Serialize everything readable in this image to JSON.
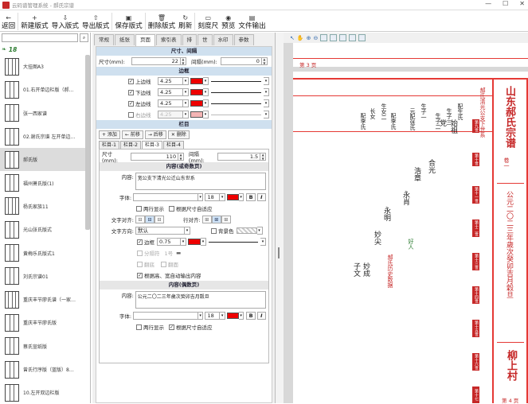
{
  "window": {
    "title": "云码谱管理系统 - 郝氏宗谱",
    "controls": [
      "—",
      "☐",
      "✕"
    ]
  },
  "toolbar": [
    {
      "icon": "←",
      "label": "返回"
    },
    {
      "icon": "+",
      "label": "新建版式"
    },
    {
      "icon": "⇩",
      "label": "导入版式"
    },
    {
      "icon": "⇧",
      "label": "导出版式"
    },
    {
      "icon": "▣",
      "label": "保存版式"
    },
    {
      "icon": "🗑",
      "label": "删除版式"
    },
    {
      "icon": "↻",
      "label": "刷新"
    },
    {
      "icon": "▭",
      "label": "刻度尺"
    },
    {
      "icon": "◉",
      "label": "预览"
    },
    {
      "icon": "▤",
      "label": "文件输出"
    }
  ],
  "left": {
    "search_placeholder": "",
    "count": "18",
    "items": [
      {
        "label": "大挂图A3",
        "cols": 4
      },
      {
        "label": "01.右开单边栏版（郝…",
        "cols": 3
      },
      {
        "label": "张一西家谱",
        "cols": 3
      },
      {
        "label": "02.谢氏宗谱 左开单边…",
        "cols": 3
      },
      {
        "label": "郝氏版",
        "cols": 3,
        "selected": true
      },
      {
        "label": "福州萧氏版(1)",
        "cols": 3
      },
      {
        "label": "杨氏家族11",
        "cols": 4
      },
      {
        "label": "光山张氏版式",
        "cols": 3
      },
      {
        "label": "黄梅乐氏版式1",
        "cols": 3
      },
      {
        "label": "刘氏宗谱01",
        "cols": 3
      },
      {
        "label": "重庆丰节廖氏谱（一家…",
        "cols": 4
      },
      {
        "label": "重庆丰节廖氏版",
        "cols": 3
      },
      {
        "label": "蔡氏宣纸版",
        "cols": 3
      },
      {
        "label": "曾氏行序版（蓝版）8…",
        "cols": 3
      },
      {
        "label": "10.左开双边栏版",
        "cols": 3
      }
    ]
  },
  "mid": {
    "tabs": [
      "常规",
      "纸张",
      "页面",
      "索引表",
      "排",
      "世",
      "水印",
      "参数"
    ],
    "active_tab": "页面",
    "sec_size": "尺寸、间隔",
    "size_label": "尺寸(mm):",
    "size_value": "22",
    "gap_label": "间隔(mm):",
    "gap_value": "0",
    "sec_border": "边框",
    "borders": [
      {
        "label": "上边线",
        "value": "4.25",
        "checked": true
      },
      {
        "label": "下边线",
        "value": "4.25",
        "checked": true
      },
      {
        "label": "左边线",
        "value": "4.25",
        "checked": true
      },
      {
        "label": "右边线",
        "value": "4.25",
        "checked": false
      }
    ],
    "sec_col": "栏目",
    "col_buttons": [
      "+ 添加",
      "← 前移",
      "→ 后移",
      "✕ 删除"
    ],
    "col_tabs": [
      "栏目-1",
      "栏目-2",
      "栏目-3",
      "栏目-4"
    ],
    "col_active": "栏目-3",
    "col_size_label": "尺寸(mm):",
    "col_size_value": "110",
    "col_gap_label": "间隔(mm):",
    "col_gap_value": "1.5",
    "odd_head": "内容(或奇数页)",
    "content_label": "内容:",
    "odd_content": "宽公支下清光公迁山东世系",
    "font_label": "字体:",
    "font_size": "18",
    "bold": "B",
    "italic": "I",
    "two_line": "两行显示",
    "fit_size": "根据尺寸自适应",
    "align_label": "文字对齐:",
    "row_label": "行对齐:",
    "dir_label": "文字方向:",
    "dir_value": "默认",
    "bg_label": "背景色",
    "border_label": "边框",
    "border_value": "0.75",
    "sep_label": "分隔符",
    "sep_value": "1号",
    "flip_h": "翻底",
    "flip_v": "翻面",
    "fit_rotate": "根据高、宽自动输出内容",
    "even_head": "内容(偶数页)",
    "even_content": "公元二〇二三年歲次癸卯吉月穀旦",
    "two_line2": "两行显示",
    "fit_size2": "根据尺寸自适应"
  },
  "preview": {
    "page_top": "第 3 页",
    "page_bottom": "第 4 页",
    "title": "山东郝氏宗谱",
    "volume": "卷一",
    "subtitle": "郝氏清光公支下世系",
    "date": "公元二〇二三年歲次癸卯吉月穀旦",
    "village": "柳上村",
    "gens": [
      "第九世",
      "第十世",
      "第十一世",
      "第十二世",
      "第十三世",
      "第十四世",
      "第十五世",
      "第十六世",
      "第十七世"
    ],
    "names": [
      "始祖",
      "党",
      "合光",
      "浩章",
      "永肖",
      "永明",
      "妙尖",
      "妙成",
      "子文"
    ],
    "notes": [
      "配生氏",
      "生子三",
      "生子二",
      "生子一",
      "元配张氏",
      "配李氏",
      "生女二",
      "长女",
      "配李氏"
    ],
    "green": "好人",
    "red_note": "郝氏历史数据"
  }
}
